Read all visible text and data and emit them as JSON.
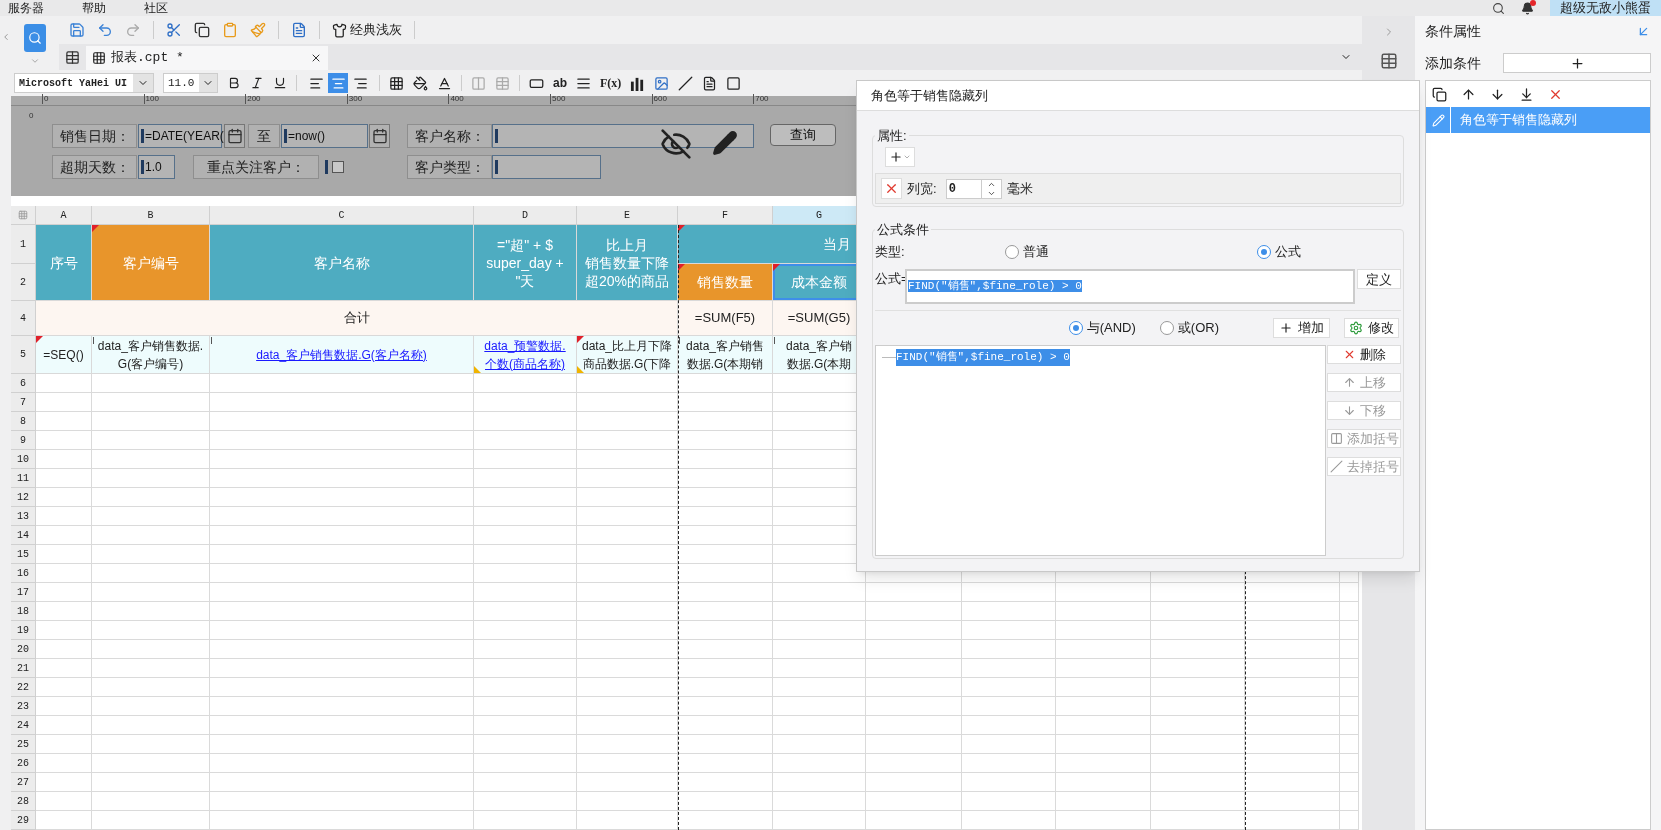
{
  "menu": [
    {
      "label": "服务器"
    },
    {
      "label": "帮助"
    },
    {
      "label": "社区"
    }
  ],
  "notifications": {
    "unread": true
  },
  "user": "超级无敌小熊蛋",
  "toolbar": {
    "theme": "经典浅灰"
  },
  "tabs": [
    {
      "label": "报表.cpt *",
      "selected": true
    }
  ],
  "format": {
    "font": "Microsoft YaHei UI",
    "size": "11.0",
    "alignments": [
      {
        "selected": false
      },
      {
        "selected": true
      },
      {
        "selected": false
      }
    ],
    "glyphs": [
      "ab",
      "F(x)"
    ]
  },
  "ruler": {
    "vertical": "0",
    "marks": [
      "0",
      "100",
      "200",
      "300",
      "400",
      "500",
      "600",
      "700"
    ]
  },
  "params": [
    {
      "kind": "label",
      "text": "销售日期："
    },
    {
      "kind": "field",
      "value": "=DATE(YEAR("
    },
    {
      "kind": "date-button"
    },
    {
      "kind": "label",
      "text": "至"
    },
    {
      "kind": "field",
      "value": "=now()"
    },
    {
      "kind": "date-button"
    },
    {
      "kind": "label",
      "text": "客户名称："
    },
    {
      "kind": "field"
    },
    {
      "kind": "button",
      "text": "查询"
    },
    {
      "kind": "label",
      "text": "超期天数："
    },
    {
      "kind": "field",
      "value": "1.0"
    },
    {
      "kind": "label",
      "text": "重点关注客户："
    },
    {
      "kind": "checkbox",
      "checked": false
    },
    {
      "kind": "label",
      "text": "客户类型："
    },
    {
      "kind": "field"
    }
  ],
  "sheet": {
    "columns": [
      {
        "label": "A",
        "selected": false
      },
      {
        "label": "B",
        "selected": false
      },
      {
        "label": "C",
        "selected": false
      },
      {
        "label": "D",
        "selected": false
      },
      {
        "label": "E",
        "selected": false
      },
      {
        "label": "F",
        "selected": false
      },
      {
        "label": "G",
        "selected": true
      }
    ],
    "top_rows": [
      "1",
      "2",
      "4",
      "5"
    ],
    "rows": [
      "6",
      "7",
      "8",
      "9",
      "10",
      "11",
      "12",
      "13",
      "14",
      "15",
      "16",
      "17",
      "18",
      "19",
      "20",
      "21",
      "22",
      "23",
      "24",
      "25",
      "26",
      "27",
      "28",
      "29"
    ],
    "cells": [
      {
        "kind": "teal",
        "lines": [
          "序号"
        ],
        "red_corner": false,
        "arrow": false,
        "yellow_corner": false,
        "selected": false
      },
      {
        "kind": "orange",
        "lines": [
          "客户编号"
        ],
        "red_corner": true,
        "arrow": false,
        "yellow_corner": false,
        "selected": false
      },
      {
        "kind": "teal",
        "lines": [
          "客户名称"
        ],
        "red_corner": false,
        "arrow": false,
        "yellow_corner": false,
        "selected": false
      },
      {
        "kind": "teal",
        "lines": [
          "=\"超\" + $",
          "super_day +",
          "\"天"
        ],
        "red_corner": false,
        "arrow": false,
        "yellow_corner": false,
        "selected": false
      },
      {
        "kind": "teal",
        "lines": [
          "比上月",
          "销售数量下降",
          "超20%的商品"
        ],
        "red_corner": false,
        "arrow": false,
        "yellow_corner": false,
        "selected": false
      },
      {
        "kind": "teal",
        "lines": [
          "当月"
        ],
        "red_corner": true,
        "arrow": false,
        "yellow_corner": false,
        "selected": false
      },
      {
        "kind": "orange",
        "lines": [
          "销售数量"
        ],
        "red_corner": true,
        "arrow": false,
        "yellow_corner": false,
        "selected": false
      },
      {
        "kind": "teal",
        "lines": [
          "成本金额"
        ],
        "red_corner": true,
        "arrow": false,
        "yellow_corner": false,
        "selected": true
      },
      {
        "kind": "total",
        "lines": [
          "合计"
        ],
        "red_corner": false,
        "arrow": false,
        "yellow_corner": false,
        "selected": false
      },
      {
        "kind": "total",
        "lines": [
          "=SUM(F5)"
        ],
        "red_corner": false,
        "arrow": false,
        "yellow_corner": false,
        "selected": false
      },
      {
        "kind": "total",
        "lines": [
          "=SUM(G5)"
        ],
        "red_corner": false,
        "arrow": false,
        "yellow_corner": false,
        "selected": false
      },
      {
        "kind": "data",
        "lines": [
          "=SEQ()"
        ],
        "red_corner": true,
        "arrow": false,
        "yellow_corner": false,
        "selected": false
      },
      {
        "kind": "data",
        "lines": [
          "data_客户销售数据.",
          "G(客户编号)"
        ],
        "red_corner": false,
        "arrow": true,
        "yellow_corner": false,
        "selected": false
      },
      {
        "kind": "link",
        "lines": [
          "data_客户销售数据.G(客户名称)"
        ],
        "red_corner": false,
        "arrow": true,
        "yellow_corner": false,
        "selected": false
      },
      {
        "kind": "link",
        "lines": [
          "data_预警数据.",
          "个数(商品名称)"
        ],
        "red_corner": false,
        "arrow": false,
        "yellow_corner": true,
        "selected": false
      },
      {
        "kind": "data",
        "lines": [
          "data_比上月下降",
          "商品数据.G(下降"
        ],
        "red_corner": true,
        "arrow": false,
        "yellow_corner": true,
        "selected": false
      },
      {
        "kind": "data",
        "lines": [
          "data_客户销售",
          "数据.G(本期销"
        ],
        "red_corner": false,
        "arrow": true,
        "yellow_corner": false,
        "selected": false
      },
      {
        "kind": "data",
        "lines": [
          "data_客户销",
          "数据.G(本期"
        ],
        "red_corner": false,
        "arrow": true,
        "yellow_corner": false,
        "selected": false
      }
    ]
  },
  "dialog": {
    "title": "角色等于销售隐藏列",
    "properties": {
      "legend": "属性:",
      "items": [
        {
          "label": "列宽:",
          "value": "0",
          "unit": "毫米"
        }
      ]
    },
    "condition": {
      "legend": "公式条件",
      "type_label": "类型:",
      "types": [
        {
          "label": "普通",
          "selected": false
        },
        {
          "label": "公式",
          "selected": true
        }
      ],
      "formula_label": "公式=",
      "formula": "FIND(\"销售\",$fine_role) > 0",
      "formula_selected": true,
      "define": "定义",
      "joins": [
        {
          "label": "与(AND)",
          "selected": true
        },
        {
          "label": "或(OR)",
          "selected": false
        }
      ],
      "add": "增加",
      "modify": "修改",
      "list": [
        {
          "text": "FIND(\"销售\",$fine_role) > 0",
          "selected": true
        }
      ],
      "actions": [
        {
          "kind": "delete",
          "label": "删除",
          "disabled": false
        },
        {
          "kind": "up",
          "label": "上移",
          "disabled": true
        },
        {
          "kind": "down",
          "label": "下移",
          "disabled": true
        },
        {
          "kind": "add-paren",
          "label": "添加括号",
          "disabled": true
        },
        {
          "kind": "remove-paren",
          "label": "去掉括号",
          "disabled": true
        }
      ]
    }
  },
  "panel": {
    "title": "条件属性",
    "add_label": "添加条件",
    "conditions": [
      {
        "label": "角色等于销售隐藏列",
        "selected": true
      }
    ]
  }
}
